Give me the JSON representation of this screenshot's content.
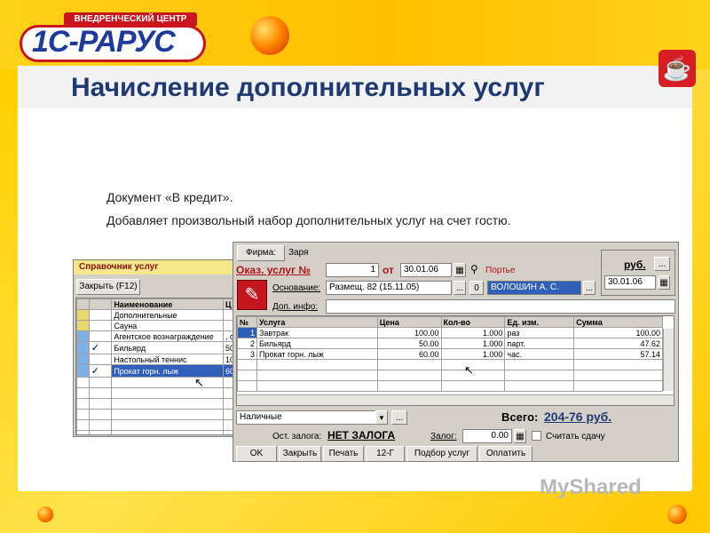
{
  "logo": {
    "top_text": "ВНЕДРЕНЧЕСКИЙ ЦЕНТР",
    "main_text": "1С-РАРУС"
  },
  "slide": {
    "title": "Начисление дополнительных услуг",
    "line1": "Документ «В кредит».",
    "line2": "Добавляет произвольный набор дополнительных услуг на счет гостю."
  },
  "services_ref": {
    "title": "Справочник услуг",
    "close_button": "Закрыть (F12)",
    "col_name": "Наименование",
    "col_code": "Ц",
    "rows": [
      {
        "name": "Дополнительные",
        "code": "",
        "check": ""
      },
      {
        "name": "Сауна",
        "code": "",
        "check": ""
      },
      {
        "name": "Агентское вознаграждение",
        "code": ", с",
        "check": ""
      },
      {
        "name": "Бильярд",
        "code": "50",
        "check": "✓"
      },
      {
        "name": "Настольный теннис",
        "code": "10",
        "check": ""
      },
      {
        "name": "Прокат горн. лыж",
        "code": "60",
        "check": "✓"
      }
    ]
  },
  "doc": {
    "firm_button": "Фирма:",
    "firm_value": "Заря",
    "doc_label": "Оказ. услуг №",
    "doc_number": "1",
    "from_label": "от",
    "doc_date": "30.01.06",
    "porter_label": "Портье",
    "currency_label": "руб.",
    "currency_date": "30.01.06",
    "basis_label": "Основание:",
    "basis_value": "Размещ. 82 (15.11.05)",
    "zero_button": "0",
    "guest_value": "ВОЛОШИН А. С.",
    "extra_info_label": "Доп. инфо:",
    "extra_info_value": "",
    "columns": [
      "№",
      "Услуга",
      "Цена",
      "Кол-во",
      "Ед. изм.",
      "Сумма"
    ],
    "rows": [
      {
        "n": "1",
        "service": "Завтрак",
        "price": "100.00",
        "qty": "1.000",
        "unit": "раз",
        "sum": "100.00"
      },
      {
        "n": "2",
        "service": "Бильярд",
        "price": "50.00",
        "qty": "1.000",
        "unit": "парт.",
        "sum": "47.62"
      },
      {
        "n": "3",
        "service": "Прокат горн. лыж",
        "price": "60.00",
        "qty": "1.000",
        "unit": "час.",
        "sum": "57.14"
      }
    ],
    "payment_value": "Наличные",
    "total_label": "Всего:",
    "total_value": "204-76 руб.",
    "deposit_rest_label": "Ост. залога:",
    "deposit_rest_value": "НЕТ ЗАЛОГА",
    "deposit_label": "Залог:",
    "deposit_value": "0.00",
    "change_label": "Считать сдачу",
    "buttons": {
      "ok": "OK",
      "close": "Закрыть",
      "print": "Печать",
      "form": "12-Г",
      "pick": "Подбор услуг",
      "pay": "Оплатить"
    }
  },
  "watermark": "MyShared"
}
